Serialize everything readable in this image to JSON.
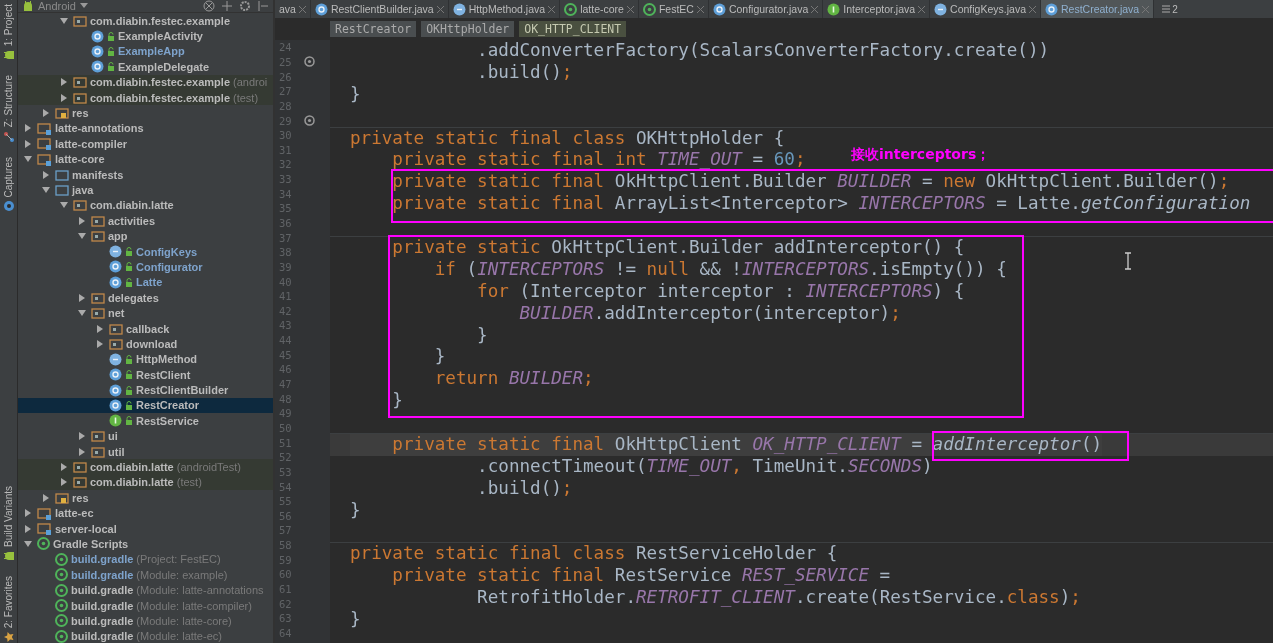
{
  "tool_strip": {
    "top": [
      {
        "label": "1: Project",
        "kind": "android"
      },
      {
        "label": "Z: Structure",
        "kind": "structure"
      },
      {
        "label": "Captures",
        "kind": "captures"
      }
    ],
    "bottom": [
      {
        "label": "Build Variants",
        "kind": "android"
      },
      {
        "label": "2: Favorites",
        "kind": "star"
      }
    ]
  },
  "project_panel": {
    "view": "Android",
    "scrolled_children": [
      {
        "label": "com.diabin.festec.example",
        "kind": "package",
        "selected": false,
        "modified": false,
        "expanded": true,
        "children": [
          {
            "label": "ExampleActivity",
            "kind": "class",
            "selected": false,
            "modified": false
          },
          {
            "label": "ExampleApp",
            "kind": "class",
            "selected": false,
            "modified": true
          },
          {
            "label": "ExampleDelegate",
            "kind": "class",
            "selected": false,
            "modified": false
          }
        ]
      },
      {
        "label": "com.diabin.festec.example",
        "suffix": "(androi",
        "kind": "test-package",
        "selected": false,
        "modified": false,
        "expanded": false
      },
      {
        "label": "com.diabin.festec.example",
        "suffix": "(test)",
        "kind": "test-package",
        "selected": false,
        "modified": false,
        "expanded": false
      }
    ],
    "scrolled_siblings": [
      {
        "label": "res",
        "kind": "res",
        "selected": false,
        "modified": false,
        "expanded": false
      }
    ],
    "modules": [
      {
        "label": "latte-annotations",
        "kind": "module",
        "selected": false,
        "modified": false,
        "expanded": false
      },
      {
        "label": "latte-compiler",
        "kind": "module",
        "selected": false,
        "modified": false,
        "expanded": false
      },
      {
        "label": "latte-core",
        "kind": "module",
        "selected": false,
        "modified": false,
        "expanded": true,
        "children": [
          {
            "label": "manifests",
            "kind": "folder",
            "selected": false,
            "modified": false,
            "expanded": false
          },
          {
            "label": "java",
            "kind": "folder",
            "selected": false,
            "modified": false,
            "expanded": true,
            "children": [
              {
                "label": "com.diabin.latte",
                "kind": "package",
                "selected": false,
                "modified": false,
                "expanded": true,
                "children": [
                  {
                    "label": "activities",
                    "kind": "package",
                    "selected": false,
                    "modified": false,
                    "expanded": false
                  },
                  {
                    "label": "app",
                    "kind": "package",
                    "selected": false,
                    "modified": false,
                    "expanded": true,
                    "children": [
                      {
                        "label": "ConfigKeys",
                        "kind": "enum",
                        "selected": false,
                        "modified": true
                      },
                      {
                        "label": "Configurator",
                        "kind": "class",
                        "selected": false,
                        "modified": true
                      },
                      {
                        "label": "Latte",
                        "kind": "class",
                        "selected": false,
                        "modified": true
                      }
                    ]
                  },
                  {
                    "label": "delegates",
                    "kind": "package",
                    "selected": false,
                    "modified": false,
                    "expanded": false
                  },
                  {
                    "label": "net",
                    "kind": "package",
                    "selected": false,
                    "modified": false,
                    "expanded": true,
                    "children": [
                      {
                        "label": "callback",
                        "kind": "package",
                        "selected": false,
                        "modified": false,
                        "expanded": false
                      },
                      {
                        "label": "download",
                        "kind": "package",
                        "selected": false,
                        "modified": false,
                        "expanded": false
                      },
                      {
                        "label": "HttpMethod",
                        "kind": "enum",
                        "selected": false,
                        "modified": false
                      },
                      {
                        "label": "RestClient",
                        "kind": "class",
                        "selected": false,
                        "modified": false
                      },
                      {
                        "label": "RestClientBuilder",
                        "kind": "class",
                        "selected": false,
                        "modified": false
                      },
                      {
                        "label": "RestCreator",
                        "kind": "class",
                        "selected": true,
                        "modified": false
                      },
                      {
                        "label": "RestService",
                        "kind": "interface",
                        "selected": false,
                        "modified": false
                      }
                    ]
                  },
                  {
                    "label": "ui",
                    "kind": "package",
                    "selected": false,
                    "modified": false,
                    "expanded": false
                  },
                  {
                    "label": "util",
                    "kind": "package",
                    "selected": false,
                    "modified": false,
                    "expanded": false
                  }
                ]
              },
              {
                "label": "com.diabin.latte",
                "suffix": "(androidTest)",
                "kind": "test-package",
                "selected": false,
                "modified": false,
                "expanded": false
              },
              {
                "label": "com.diabin.latte",
                "suffix": "(test)",
                "kind": "test-package",
                "selected": false,
                "modified": false,
                "expanded": false
              }
            ]
          },
          {
            "label": "res",
            "kind": "res",
            "selected": false,
            "modified": false,
            "expanded": false
          }
        ]
      },
      {
        "label": "latte-ec",
        "kind": "module",
        "selected": false,
        "modified": false,
        "expanded": false
      },
      {
        "label": "server-local",
        "kind": "module",
        "selected": false,
        "modified": false,
        "expanded": false
      },
      {
        "label": "Gradle Scripts",
        "kind": "gradle",
        "selected": false,
        "modified": false,
        "expanded": true,
        "children": [
          {
            "label": "build.gradle",
            "suffix": "(Project: FestEC)",
            "kind": "gradle",
            "selected": false,
            "modified": true
          },
          {
            "label": "build.gradle",
            "suffix": "(Module: example)",
            "kind": "gradle",
            "selected": false,
            "modified": true
          },
          {
            "label": "build.gradle",
            "suffix": "(Module: latte-annotations",
            "kind": "gradle",
            "selected": false,
            "modified": false
          },
          {
            "label": "build.gradle",
            "suffix": "(Module: latte-compiler)",
            "kind": "gradle",
            "selected": false,
            "modified": false
          },
          {
            "label": "build.gradle",
            "suffix": "(Module: latte-core)",
            "kind": "gradle",
            "selected": false,
            "modified": false
          },
          {
            "label": "build.gradle",
            "suffix": "(Module: latte-ec)",
            "kind": "gradle",
            "selected": false,
            "modified": false
          }
        ]
      }
    ]
  },
  "tabs": [
    {
      "label": "ava",
      "kind": "none",
      "selected": false
    },
    {
      "label": "RestClientBuilder.java",
      "kind": "class",
      "selected": false
    },
    {
      "label": "HttpMethod.java",
      "kind": "enum",
      "selected": false
    },
    {
      "label": "latte-core",
      "kind": "gradle",
      "selected": false
    },
    {
      "label": "FestEC",
      "kind": "gradle",
      "selected": false
    },
    {
      "label": "Configurator.java",
      "kind": "class",
      "selected": false
    },
    {
      "label": "Interceptor.java",
      "kind": "interface",
      "selected": false
    },
    {
      "label": "ConfigKeys.java",
      "kind": "enum",
      "selected": false
    },
    {
      "label": "RestCreator.java",
      "kind": "class",
      "selected": true
    }
  ],
  "tab_overflow": "2",
  "breadcrumbs": [
    {
      "label": "RestCreator",
      "selected": false
    },
    {
      "label": "OKHttpHolder",
      "selected": false
    },
    {
      "label": "OK_HTTP_CLIENT",
      "selected": true
    }
  ],
  "gutter": [
    {
      "number": "24",
      "override": false
    },
    {
      "number": "25",
      "override": true
    },
    {
      "number": "26",
      "override": false
    },
    {
      "number": "27",
      "override": false
    },
    {
      "number": "28",
      "override": false
    },
    {
      "number": "29",
      "override": true
    },
    {
      "number": "30",
      "override": false
    },
    {
      "number": "31",
      "override": false
    },
    {
      "number": "32",
      "override": false
    },
    {
      "number": "33",
      "override": false
    },
    {
      "number": "34",
      "override": false
    },
    {
      "number": "35",
      "override": false
    },
    {
      "number": "36",
      "override": false
    },
    {
      "number": "37",
      "override": false
    },
    {
      "number": "38",
      "override": false
    },
    {
      "number": "39",
      "override": false
    },
    {
      "number": "40",
      "override": false
    },
    {
      "number": "41",
      "override": false
    },
    {
      "number": "42",
      "override": false
    },
    {
      "number": "43",
      "override": false
    },
    {
      "number": "44",
      "override": false
    },
    {
      "number": "45",
      "override": false
    },
    {
      "number": "46",
      "override": false
    },
    {
      "number": "47",
      "override": false
    },
    {
      "number": "48",
      "override": false
    },
    {
      "number": "49",
      "override": false
    },
    {
      "number": "50",
      "override": false
    },
    {
      "number": "51",
      "override": false
    },
    {
      "number": "52",
      "override": false
    },
    {
      "number": "53",
      "override": false
    },
    {
      "number": "54",
      "override": false
    },
    {
      "number": "55",
      "override": false
    },
    {
      "number": "56",
      "override": false
    },
    {
      "number": "57",
      "override": false
    },
    {
      "number": "58",
      "override": false
    },
    {
      "number": "59",
      "override": false
    },
    {
      "number": "60",
      "override": false
    },
    {
      "number": "61",
      "override": false
    },
    {
      "number": "62",
      "override": false
    },
    {
      "number": "63",
      "override": false
    },
    {
      "number": "64",
      "override": false
    }
  ],
  "code": [
    {
      "kind": "code",
      "current": false,
      "tokens": [
        {
          "text": "            .addConverterFactory(ScalarsConverterFactory.create())",
          "kind": "plain"
        }
      ]
    },
    {
      "kind": "code",
      "current": false,
      "tokens": [
        {
          "text": "            .build()",
          "kind": "plain"
        },
        {
          "text": ";",
          "kind": "punct"
        }
      ]
    },
    {
      "kind": "code",
      "current": false,
      "tokens": [
        {
          "text": "}",
          "kind": "plain"
        }
      ]
    },
    {
      "kind": "separator"
    },
    {
      "kind": "code",
      "current": false,
      "tokens": [
        {
          "text": "private static final class ",
          "kind": "kw"
        },
        {
          "text": "OKHttpHolder {",
          "kind": "plain"
        }
      ]
    },
    {
      "kind": "code",
      "current": false,
      "tokens": [
        {
          "text": "    private static final int ",
          "kind": "kw"
        },
        {
          "text": "TIME_OUT",
          "kind": "const"
        },
        {
          "text": " = ",
          "kind": "plain"
        },
        {
          "text": "60",
          "kind": "num"
        },
        {
          "text": ";",
          "kind": "punct"
        }
      ]
    },
    {
      "kind": "code",
      "current": false,
      "tokens": [
        {
          "text": "    private static final ",
          "kind": "kw"
        },
        {
          "text": "OkHttpClient.Builder ",
          "kind": "plain"
        },
        {
          "text": "BUILDER",
          "kind": "const"
        },
        {
          "text": " = ",
          "kind": "plain"
        },
        {
          "text": "new ",
          "kind": "kw"
        },
        {
          "text": "OkHttpClient.Builder()",
          "kind": "plain"
        },
        {
          "text": ";",
          "kind": "punct"
        }
      ]
    },
    {
      "kind": "code",
      "current": false,
      "tokens": [
        {
          "text": "    private static final ",
          "kind": "kw"
        },
        {
          "text": "ArrayList<Interceptor> ",
          "kind": "plain"
        },
        {
          "text": "INTERCEPTORS",
          "kind": "const"
        },
        {
          "text": " = Latte.",
          "kind": "plain"
        },
        {
          "text": "getConfiguration",
          "kind": "call"
        }
      ]
    },
    {
      "kind": "separator"
    },
    {
      "kind": "code",
      "current": false,
      "tokens": [
        {
          "text": "    private static ",
          "kind": "kw"
        },
        {
          "text": "OkHttpClient.Builder addInterceptor() {",
          "kind": "plain"
        }
      ]
    },
    {
      "kind": "code",
      "current": false,
      "tokens": [
        {
          "text": "        if ",
          "kind": "kw"
        },
        {
          "text": "(",
          "kind": "plain"
        },
        {
          "text": "INTERCEPTORS",
          "kind": "const"
        },
        {
          "text": " != ",
          "kind": "plain"
        },
        {
          "text": "null ",
          "kind": "kw"
        },
        {
          "text": "&& !",
          "kind": "plain"
        },
        {
          "text": "INTERCEPTORS",
          "kind": "const"
        },
        {
          "text": ".isEmpty()) {",
          "kind": "plain"
        }
      ]
    },
    {
      "kind": "code",
      "current": false,
      "tokens": [
        {
          "text": "            for ",
          "kind": "kw"
        },
        {
          "text": "(Interceptor interceptor : ",
          "kind": "plain"
        },
        {
          "text": "INTERCEPTORS",
          "kind": "const"
        },
        {
          "text": ") {",
          "kind": "plain"
        }
      ]
    },
    {
      "kind": "code",
      "current": false,
      "tokens": [
        {
          "text": "                BUILDER",
          "kind": "const"
        },
        {
          "text": ".addInterceptor(interceptor)",
          "kind": "plain"
        },
        {
          "text": ";",
          "kind": "punct"
        }
      ]
    },
    {
      "kind": "code",
      "current": false,
      "tokens": [
        {
          "text": "            }",
          "kind": "plain"
        }
      ]
    },
    {
      "kind": "code",
      "current": false,
      "tokens": [
        {
          "text": "        }",
          "kind": "plain"
        }
      ]
    },
    {
      "kind": "code",
      "current": false,
      "tokens": [
        {
          "text": "        return ",
          "kind": "kw"
        },
        {
          "text": "BUILDER",
          "kind": "const"
        },
        {
          "text": ";",
          "kind": "punct"
        }
      ]
    },
    {
      "kind": "code",
      "current": false,
      "tokens": [
        {
          "text": "    }",
          "kind": "plain"
        }
      ]
    },
    {
      "kind": "separator"
    },
    {
      "kind": "code",
      "current": true,
      "tokens": [
        {
          "text": "    private static final ",
          "kind": "kw"
        },
        {
          "text": "OkHttpClient ",
          "kind": "plain"
        },
        {
          "text": "OK_HTTP_CLIENT",
          "kind": "const"
        },
        {
          "text": " = ",
          "kind": "plain"
        },
        {
          "text": "addInterceptor",
          "kind": "call"
        },
        {
          "text": "()",
          "kind": "plain"
        }
      ]
    },
    {
      "kind": "code",
      "current": false,
      "tokens": [
        {
          "text": "            .connectTimeout(",
          "kind": "plain"
        },
        {
          "text": "TIME_OUT",
          "kind": "const"
        },
        {
          "text": ", ",
          "kind": "punct"
        },
        {
          "text": "TimeUnit.",
          "kind": "plain"
        },
        {
          "text": "SECONDS",
          "kind": "const"
        },
        {
          "text": ")",
          "kind": "plain"
        }
      ]
    },
    {
      "kind": "code",
      "current": false,
      "tokens": [
        {
          "text": "            .build()",
          "kind": "plain"
        },
        {
          "text": ";",
          "kind": "punct"
        }
      ]
    },
    {
      "kind": "code",
      "current": false,
      "tokens": [
        {
          "text": "}",
          "kind": "plain"
        }
      ]
    },
    {
      "kind": "separator"
    },
    {
      "kind": "code",
      "current": false,
      "tokens": [
        {
          "text": "private static final class ",
          "kind": "kw"
        },
        {
          "text": "RestServiceHolder {",
          "kind": "plain"
        }
      ]
    },
    {
      "kind": "code",
      "current": false,
      "tokens": [
        {
          "text": "    private static final ",
          "kind": "kw"
        },
        {
          "text": "RestService ",
          "kind": "plain"
        },
        {
          "text": "REST_SERVICE",
          "kind": "const"
        },
        {
          "text": " =",
          "kind": "plain"
        }
      ]
    },
    {
      "kind": "code",
      "current": false,
      "tokens": [
        {
          "text": "            RetrofitHolder.",
          "kind": "plain"
        },
        {
          "text": "RETROFIT_CLIENT",
          "kind": "const"
        },
        {
          "text": ".create(RestService.",
          "kind": "plain"
        },
        {
          "text": "class",
          "kind": "kw"
        },
        {
          "text": ")",
          "kind": "plain"
        },
        {
          "text": ";",
          "kind": "punct"
        }
      ]
    },
    {
      "kind": "code",
      "current": false,
      "tokens": [
        {
          "text": "}",
          "kind": "plain"
        }
      ]
    }
  ],
  "annotation": {
    "note": "接收interceptors；"
  }
}
